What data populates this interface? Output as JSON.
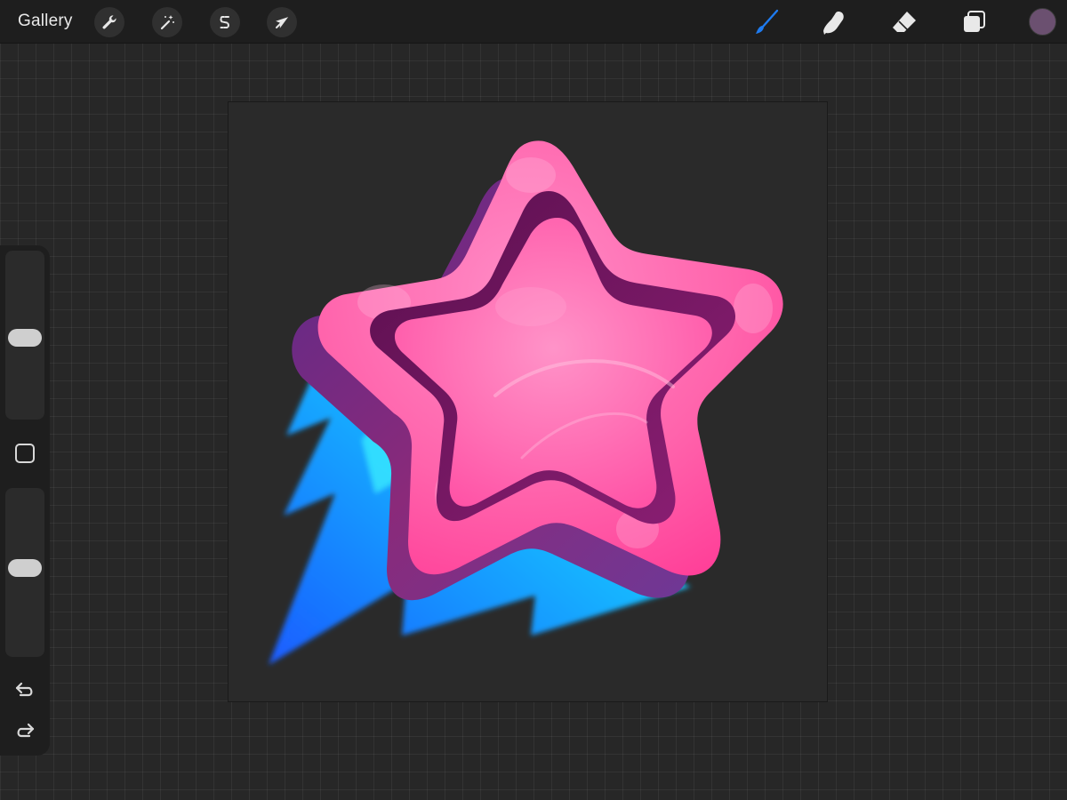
{
  "app": {
    "gallery_label": "Gallery"
  },
  "toolbar_left": {
    "actions_icon": "wrench-icon",
    "adjustments_icon": "magic-wand-icon",
    "selection_icon": "selection-s-icon",
    "transform_icon": "arrow-cursor-icon"
  },
  "toolbar_right": {
    "brush_icon": "paintbrush-icon",
    "smudge_icon": "smudge-finger-icon",
    "eraser_icon": "eraser-icon",
    "layers_icon": "layers-icon",
    "current_color": "#6b5070",
    "active_tool": "brush",
    "accent_color": "#1e7bf0"
  },
  "sidebar": {
    "brush_size_level": 0.48,
    "opacity_level": 0.53,
    "modify_icon": "square-icon",
    "undo_icon": "undo-arrow-icon",
    "redo_icon": "redo-arrow-icon"
  },
  "artwork": {
    "subject": "pink-star-with-blue-speed-trail",
    "colors": {
      "star_top": "#ff6fb3",
      "star_edge": "#ff4fa0",
      "star_inner": "#ff5ca8",
      "star_depth": "#6a1a5a",
      "trail_light": "#2ee6ff",
      "trail_dark": "#1a6cff"
    }
  }
}
